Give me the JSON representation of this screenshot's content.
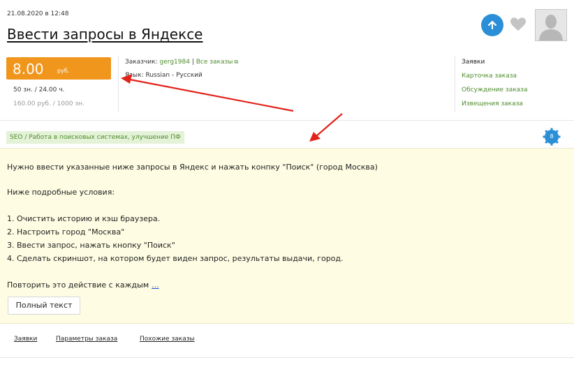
{
  "header": {
    "date": "21.08.2020 в 12:48",
    "title": "Ввести запросы в Яндексе"
  },
  "icons": {
    "up": "arrow-up-icon",
    "favorite": "heart-icon",
    "avatar": "user-avatar-icon",
    "external": "external-link-icon",
    "badge": "gear-badge-icon"
  },
  "colors": {
    "price_bg": "#f0961c",
    "link_green": "#4d8c2c",
    "up_button": "#2a8fd6",
    "description_bg": "#fefde3",
    "arrow_red": "#e2231a",
    "badge_blue": "#2a8fd6"
  },
  "price": {
    "amount": "8.00",
    "unit": "руб.",
    "meta": "50 зн.  /  24.00 ч.",
    "sub": "160.00 руб.  /  1000 зн."
  },
  "info": {
    "customer_label": "Заказчик: ",
    "customer_name": "gerg1984",
    "separator": " | ",
    "all_orders": "Все заказы",
    "language": "Язык: Russian - Русский"
  },
  "side": {
    "heading": "Заявки",
    "links": [
      "Карточка заказа",
      "Обсуждение заказа",
      "Извещения заказа"
    ]
  },
  "category": {
    "tag": "SEO  /  Работа в поисковых системах, улучшение ПФ",
    "badge": "8"
  },
  "description": {
    "lines": [
      "Нужно ввести указанные ниже запросы в Яндекс и нажать конпку \"Поиск\" (город Москва)",
      "Ниже подробные условия:",
      "1. Очистить историю и кэш браузера.",
      "2. Настроить город \"Москва\"",
      "3. Ввести запрос, нажать кнопку \"Поиск\"",
      "4. Сделать скриншот, на котором будет виден запрос, результаты выдачи, город."
    ],
    "last_line": "Повторить это действие с каждым",
    "more": "...",
    "full_button": "Полный текст"
  },
  "tabs": [
    "Заявки",
    "Параметры заказа",
    "Похожие заказы"
  ]
}
